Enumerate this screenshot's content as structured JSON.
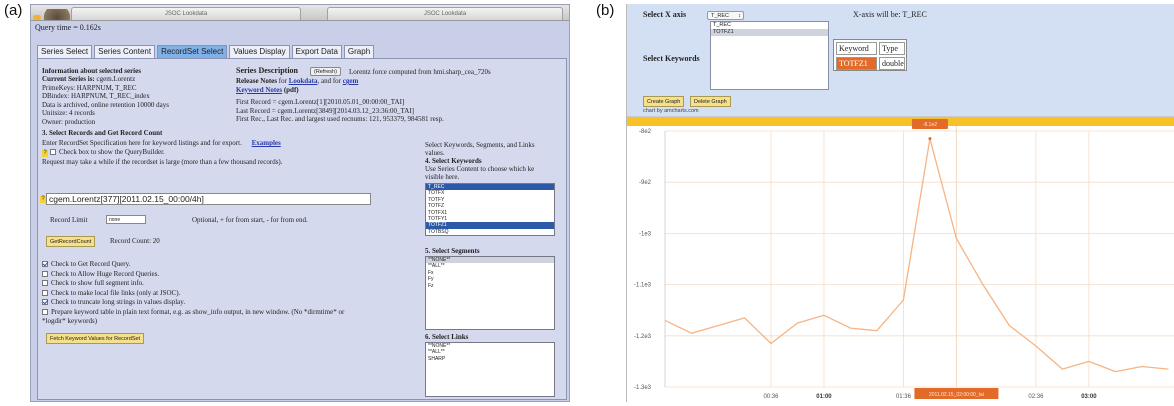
{
  "panels": {
    "a": "(a)",
    "b": "(b)"
  },
  "panel_a": {
    "browser_tabs": [
      "JSOC Lookdata",
      "JSOC Lookdata"
    ],
    "query_time": "Query time = 0.162s",
    "tabs": [
      {
        "label": "Series Select",
        "active": false
      },
      {
        "label": "Series Content",
        "active": false
      },
      {
        "label": "RecordSet Select",
        "active": true
      },
      {
        "label": "Values Display",
        "active": false
      },
      {
        "label": "Export Data",
        "active": false
      },
      {
        "label": "Graph",
        "active": false
      }
    ],
    "info": {
      "heading": "Information about selected series",
      "current_series_label": "Current Series is:",
      "current_series_value": "cgem.Lorentz",
      "primekeys": "PrimeKeys: HARPNUM, T_REC",
      "dbindex": "DBindex: HARPNUM, T_REC_index",
      "archived": "Data is archived, online retention 10000 days",
      "unitsize": "Unitsize: 4 records",
      "owner": "Owner: production"
    },
    "description": {
      "label": "Series Description",
      "refresh_button": "(Refresh)",
      "text": "Lorentz force computed from hmi.sharp_cea_720s",
      "release_notes_prefix": "Release Notes",
      "release_notes_for": "for",
      "lookdata_link": "Lookdata",
      "and_for": ", and for",
      "cgem_link": "cgem",
      "keyword_notes_link": "Keyword Notes",
      "pdf": "(pdf)",
      "first_record": "First Record = cgem.Lorentz[1][2010.05.01_00:00:00_TAI]",
      "last_record": "Last Record = cgem.Lorentz[3849][2014.03.12_23:36:00_TAI]",
      "recnums": "First Rec., Last Rec. and largest used recnums: 121, 953379, 984581 resp."
    },
    "section3": {
      "heading": "3. Select Records and Get Record Count",
      "enter_spec": "Enter RecordSet Specification here for keyword listings and for export.",
      "examples_link": "Examples",
      "querybuilder": "Check box to show the QueryBuilder.",
      "request_note": "Request may take a while if the recordset is large (more than a few thousand records).",
      "spec_value": "cgem.Lorentz[377][2011.02.15_00:00/4h]",
      "record_limit_label": "Record Limit",
      "record_limit_value": "none",
      "record_limit_note": "Optional, + for from start, - for from end.",
      "get_count_button": "GetRecordCount",
      "record_count": "Record Count:  20"
    },
    "checks": [
      {
        "label": "Check to Get Record Query.",
        "checked": true
      },
      {
        "label": "Check to Allow Huge Record Queries.",
        "checked": false
      },
      {
        "label": "Check to show full segment info.",
        "checked": false
      },
      {
        "label": "Check to make local file links (only at JSOC).",
        "checked": false
      },
      {
        "label": "Check to truncate long strings in values display.",
        "checked": true
      },
      {
        "label": "Prepare keyword table in plain text format, e.g. as show_info output, in new window. (No *dirmtime* or",
        "checked": false
      }
    ],
    "logdir_note": "*logdir* keywords)",
    "fetch_button": "Fetch Keyword Values for RecordSet",
    "right_col": {
      "intro1": "Select Keywords, Segments, and Links",
      "intro2": "values.",
      "kw_heading": "4. Select Keywords",
      "kw_note1": "Use Series Content to choose which ke",
      "kw_note2": "visible here.",
      "keywords": [
        {
          "label": "T_REC",
          "state": "sel"
        },
        {
          "label": "TOTFX",
          "state": ""
        },
        {
          "label": "TOTFY",
          "state": ""
        },
        {
          "label": "TOTFZ",
          "state": ""
        },
        {
          "label": "TOTFX1",
          "state": ""
        },
        {
          "label": "TOTFY1",
          "state": ""
        },
        {
          "label": "TOTFZ1",
          "state": "sel"
        },
        {
          "label": "TOTBSQ",
          "state": ""
        }
      ],
      "seg_heading": "5. Select Segments",
      "segments": [
        {
          "label": "**NONE**",
          "state": "sel-light"
        },
        {
          "label": "**ALL**",
          "state": ""
        },
        {
          "label": "Fx",
          "state": ""
        },
        {
          "label": "Fy",
          "state": ""
        },
        {
          "label": "Fz",
          "state": ""
        }
      ],
      "links_heading": "6. Select Links",
      "links": [
        {
          "label": "**NONE**",
          "state": ""
        },
        {
          "label": "**ALL**",
          "state": ""
        },
        {
          "label": "SHARP",
          "state": ""
        }
      ]
    }
  },
  "panel_b": {
    "select_x_axis": "Select X axis",
    "x_axis_value": "T_REC",
    "x_axis_note": "X-axis will be: T_REC",
    "select_keywords": "Select Keywords",
    "keyword_options": [
      {
        "label": "T_REC",
        "state": ""
      },
      {
        "label": "TOTFZ1",
        "state": "sel-light"
      }
    ],
    "table": {
      "h1": "Keyword",
      "h2": "Type",
      "kw": "TOTFZ1",
      "type": "double"
    },
    "create_button": "Create Graph",
    "delete_button": "Delete Graph",
    "credit": "chart by amcharts.com",
    "colors": {
      "line": "#f7b383",
      "bar": "#f6c228",
      "balloon": "#e36b2a",
      "grid": "#f6dcc6"
    }
  },
  "chart_data": {
    "type": "line",
    "y_ticks": [
      "-8e2",
      "-9e2",
      "-1e3",
      "-1.1e3",
      "-1.2e3",
      "-1.3e3"
    ],
    "y_tick_values": [
      -800,
      -900,
      -1000,
      -1100,
      -1200,
      -1300
    ],
    "ylim": [
      -1300,
      -800
    ],
    "x_ticks": [
      {
        "label": "00:36",
        "bold": false,
        "t": 0.6
      },
      {
        "label": "01:00",
        "bold": true,
        "t": 1.0
      },
      {
        "label": "01:36",
        "bold": false,
        "t": 1.6
      },
      {
        "label": "02:36",
        "bold": false,
        "t": 2.6
      },
      {
        "label": "03:00",
        "bold": true,
        "t": 3.0
      }
    ],
    "xlim": [
      -0.2,
      3.65
    ],
    "x": [
      -0.2,
      -0.0,
      0.2,
      0.4,
      0.6,
      0.8,
      1.0,
      1.2,
      1.4,
      1.6,
      1.8,
      2.0,
      2.2,
      2.4,
      2.6,
      2.8,
      3.0,
      3.2,
      3.4,
      3.6
    ],
    "values": [
      -1170,
      -1195,
      -1180,
      -1165,
      -1215,
      -1175,
      -1160,
      -1185,
      -1190,
      -1130,
      -815,
      -1010,
      -1100,
      -1180,
      -1220,
      -1265,
      -1250,
      -1270,
      -1260,
      -1265
    ],
    "balloon_value": "-8.1e2",
    "cursor_label": "2011.02.15_02:00:00_tai",
    "cursor_t": 2.0
  }
}
